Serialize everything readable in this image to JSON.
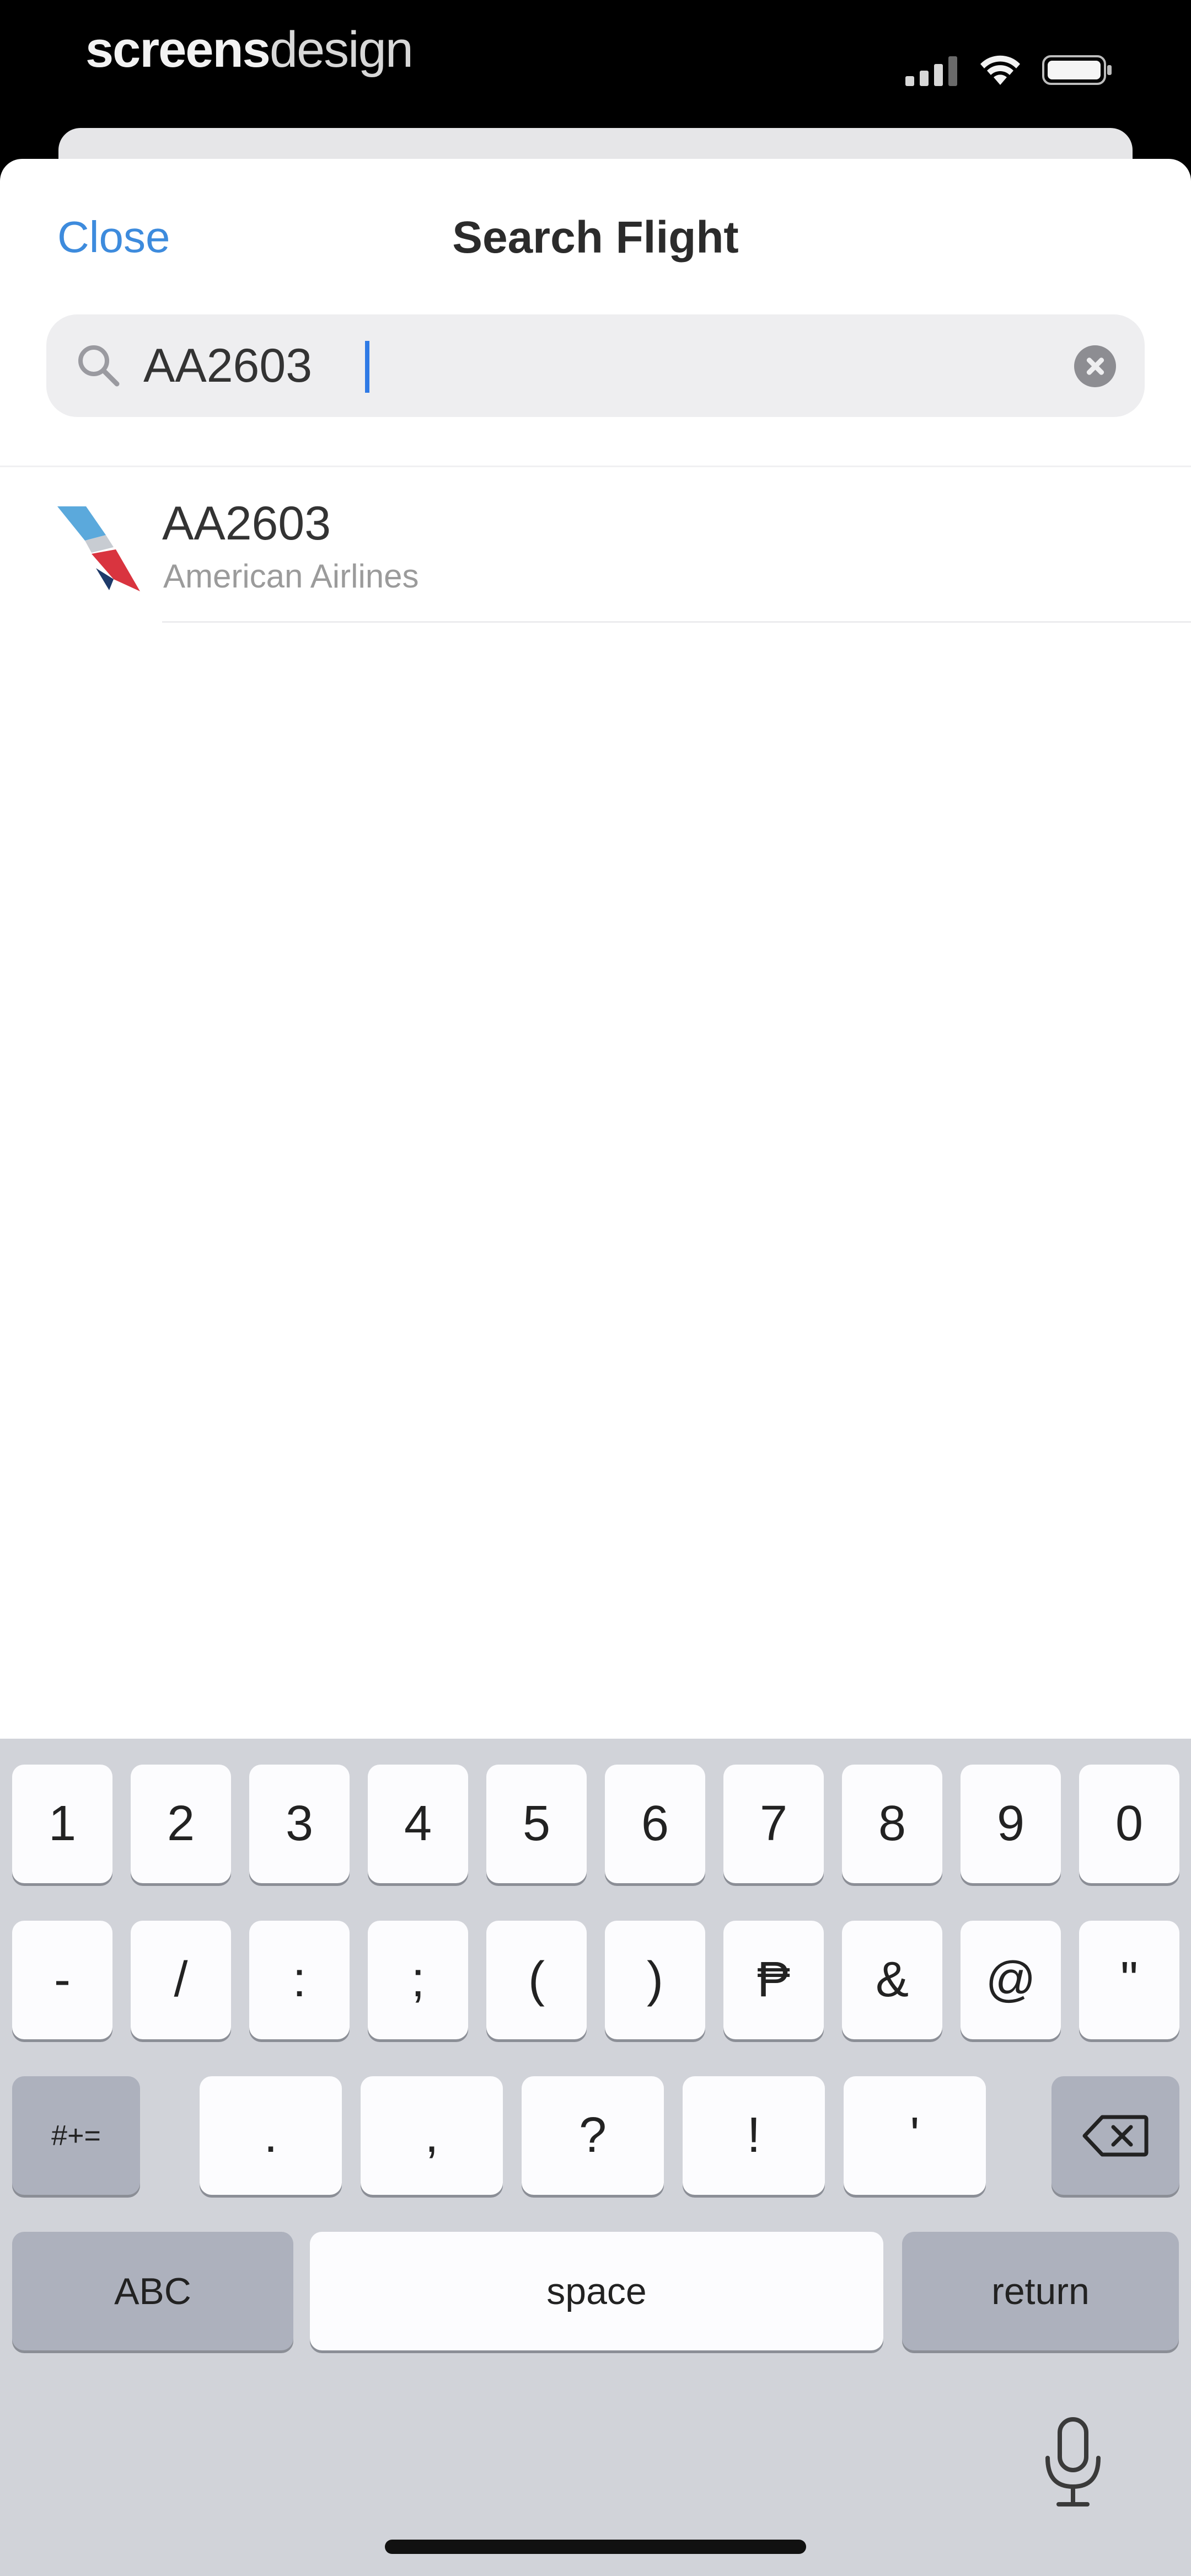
{
  "status_bar": {
    "brand_bold": "screens",
    "brand_light": "design",
    "icons": [
      "cellular-signal-icon",
      "wifi-icon",
      "battery-icon"
    ]
  },
  "nav": {
    "close_label": "Close",
    "title": "Search Flight"
  },
  "search": {
    "value": "AA2603",
    "placeholder": ""
  },
  "results": [
    {
      "flight_code": "AA2603",
      "airline": "American Airlines",
      "logo": "american-airlines-logo-icon"
    }
  ],
  "keyboard": {
    "row1": [
      "1",
      "2",
      "3",
      "4",
      "5",
      "6",
      "7",
      "8",
      "9",
      "0"
    ],
    "row2": [
      "-",
      "/",
      ":",
      ";",
      "(",
      ")",
      "₱",
      "&",
      "@",
      "\""
    ],
    "row3_toggle": "#+=",
    "row3": [
      ".",
      ",",
      "?",
      "!",
      "'"
    ],
    "abc": "ABC",
    "space": "space",
    "return": "return"
  },
  "colors": {
    "accent": "#3d8bdd",
    "keyboard_bg": "#d1d3d9",
    "key_dark": "#adb1bd"
  }
}
